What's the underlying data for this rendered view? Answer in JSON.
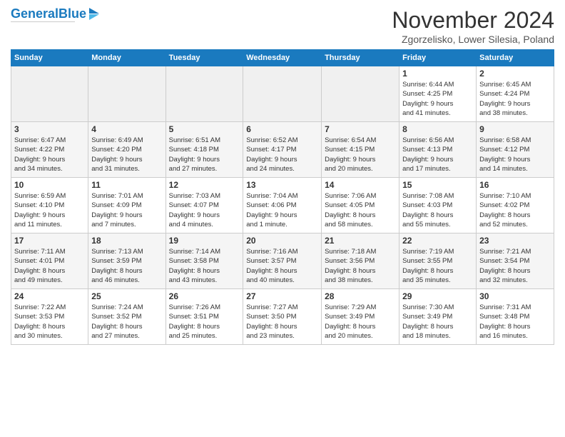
{
  "header": {
    "logo_general": "General",
    "logo_blue": "Blue",
    "month": "November 2024",
    "location": "Zgorzelisko, Lower Silesia, Poland"
  },
  "days_of_week": [
    "Sunday",
    "Monday",
    "Tuesday",
    "Wednesday",
    "Thursday",
    "Friday",
    "Saturday"
  ],
  "weeks": [
    [
      {
        "day": "",
        "info": ""
      },
      {
        "day": "",
        "info": ""
      },
      {
        "day": "",
        "info": ""
      },
      {
        "day": "",
        "info": ""
      },
      {
        "day": "",
        "info": ""
      },
      {
        "day": "1",
        "info": "Sunrise: 6:44 AM\nSunset: 4:25 PM\nDaylight: 9 hours\nand 41 minutes."
      },
      {
        "day": "2",
        "info": "Sunrise: 6:45 AM\nSunset: 4:24 PM\nDaylight: 9 hours\nand 38 minutes."
      }
    ],
    [
      {
        "day": "3",
        "info": "Sunrise: 6:47 AM\nSunset: 4:22 PM\nDaylight: 9 hours\nand 34 minutes."
      },
      {
        "day": "4",
        "info": "Sunrise: 6:49 AM\nSunset: 4:20 PM\nDaylight: 9 hours\nand 31 minutes."
      },
      {
        "day": "5",
        "info": "Sunrise: 6:51 AM\nSunset: 4:18 PM\nDaylight: 9 hours\nand 27 minutes."
      },
      {
        "day": "6",
        "info": "Sunrise: 6:52 AM\nSunset: 4:17 PM\nDaylight: 9 hours\nand 24 minutes."
      },
      {
        "day": "7",
        "info": "Sunrise: 6:54 AM\nSunset: 4:15 PM\nDaylight: 9 hours\nand 20 minutes."
      },
      {
        "day": "8",
        "info": "Sunrise: 6:56 AM\nSunset: 4:13 PM\nDaylight: 9 hours\nand 17 minutes."
      },
      {
        "day": "9",
        "info": "Sunrise: 6:58 AM\nSunset: 4:12 PM\nDaylight: 9 hours\nand 14 minutes."
      }
    ],
    [
      {
        "day": "10",
        "info": "Sunrise: 6:59 AM\nSunset: 4:10 PM\nDaylight: 9 hours\nand 11 minutes."
      },
      {
        "day": "11",
        "info": "Sunrise: 7:01 AM\nSunset: 4:09 PM\nDaylight: 9 hours\nand 7 minutes."
      },
      {
        "day": "12",
        "info": "Sunrise: 7:03 AM\nSunset: 4:07 PM\nDaylight: 9 hours\nand 4 minutes."
      },
      {
        "day": "13",
        "info": "Sunrise: 7:04 AM\nSunset: 4:06 PM\nDaylight: 9 hours\nand 1 minute."
      },
      {
        "day": "14",
        "info": "Sunrise: 7:06 AM\nSunset: 4:05 PM\nDaylight: 8 hours\nand 58 minutes."
      },
      {
        "day": "15",
        "info": "Sunrise: 7:08 AM\nSunset: 4:03 PM\nDaylight: 8 hours\nand 55 minutes."
      },
      {
        "day": "16",
        "info": "Sunrise: 7:10 AM\nSunset: 4:02 PM\nDaylight: 8 hours\nand 52 minutes."
      }
    ],
    [
      {
        "day": "17",
        "info": "Sunrise: 7:11 AM\nSunset: 4:01 PM\nDaylight: 8 hours\nand 49 minutes."
      },
      {
        "day": "18",
        "info": "Sunrise: 7:13 AM\nSunset: 3:59 PM\nDaylight: 8 hours\nand 46 minutes."
      },
      {
        "day": "19",
        "info": "Sunrise: 7:14 AM\nSunset: 3:58 PM\nDaylight: 8 hours\nand 43 minutes."
      },
      {
        "day": "20",
        "info": "Sunrise: 7:16 AM\nSunset: 3:57 PM\nDaylight: 8 hours\nand 40 minutes."
      },
      {
        "day": "21",
        "info": "Sunrise: 7:18 AM\nSunset: 3:56 PM\nDaylight: 8 hours\nand 38 minutes."
      },
      {
        "day": "22",
        "info": "Sunrise: 7:19 AM\nSunset: 3:55 PM\nDaylight: 8 hours\nand 35 minutes."
      },
      {
        "day": "23",
        "info": "Sunrise: 7:21 AM\nSunset: 3:54 PM\nDaylight: 8 hours\nand 32 minutes."
      }
    ],
    [
      {
        "day": "24",
        "info": "Sunrise: 7:22 AM\nSunset: 3:53 PM\nDaylight: 8 hours\nand 30 minutes."
      },
      {
        "day": "25",
        "info": "Sunrise: 7:24 AM\nSunset: 3:52 PM\nDaylight: 8 hours\nand 27 minutes."
      },
      {
        "day": "26",
        "info": "Sunrise: 7:26 AM\nSunset: 3:51 PM\nDaylight: 8 hours\nand 25 minutes."
      },
      {
        "day": "27",
        "info": "Sunrise: 7:27 AM\nSunset: 3:50 PM\nDaylight: 8 hours\nand 23 minutes."
      },
      {
        "day": "28",
        "info": "Sunrise: 7:29 AM\nSunset: 3:49 PM\nDaylight: 8 hours\nand 20 minutes."
      },
      {
        "day": "29",
        "info": "Sunrise: 7:30 AM\nSunset: 3:49 PM\nDaylight: 8 hours\nand 18 minutes."
      },
      {
        "day": "30",
        "info": "Sunrise: 7:31 AM\nSunset: 3:48 PM\nDaylight: 8 hours\nand 16 minutes."
      }
    ]
  ]
}
